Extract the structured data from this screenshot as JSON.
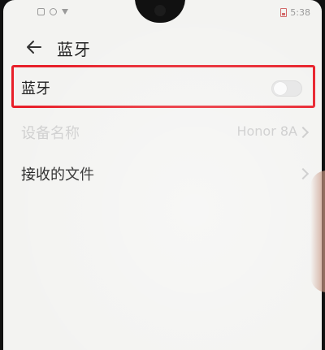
{
  "status_bar": {
    "time": "5:38"
  },
  "header": {
    "back_icon": "arrow-left-icon",
    "title": "蓝牙"
  },
  "settings": {
    "bluetooth": {
      "label": "蓝牙",
      "enabled": false,
      "toggle_icon": "toggle-switch-icon"
    },
    "device_name": {
      "label": "设备名称",
      "value": "Honor 8A",
      "disabled": true
    },
    "received_files": {
      "label": "接收的文件"
    }
  },
  "colors": {
    "highlight_border": "#e8202a",
    "background": "#f3f3f1",
    "text_primary": "#222222",
    "text_disabled": "#cfcfcf"
  }
}
